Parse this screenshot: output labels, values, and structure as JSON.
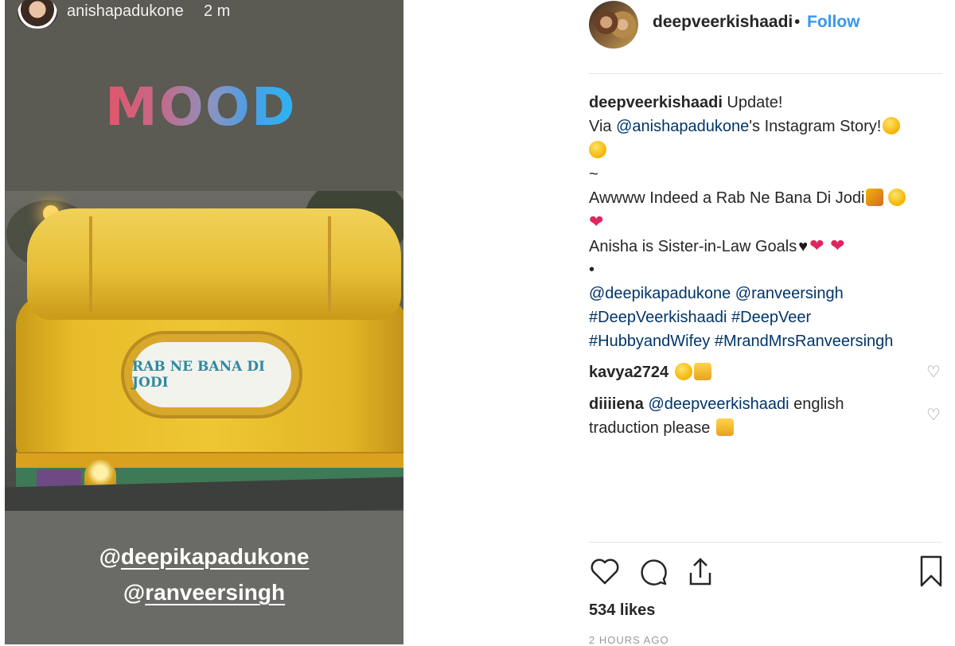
{
  "story": {
    "username": "anishapadukone",
    "time": "2 m",
    "sticker": "MOOD",
    "sign_text": "RAB NE BANA DI JODI",
    "mention_1": "deepikapadukone",
    "mention_2": "ranveersingh",
    "at": "@"
  },
  "post": {
    "username": "deepveerkishaadi",
    "dot": "•",
    "follow_label": "Follow",
    "caption": {
      "line1_user": "deepveerkishaadi",
      "line1_text": " Update!",
      "line2_pre": "Via ",
      "line2_mention": "@anishapadukone",
      "line2_post": "'s Instagram Story!",
      "line4": "~",
      "line5": "Awwww Indeed a Rab Ne Bana Di Jodi",
      "line7": "Anisha is Sister-in-Law Goals",
      "line8": "•",
      "line9_m1": "@deepikapadukone",
      "line9_m2": "@ranveersingh",
      "line10_t1": "#DeepVeerkishaadi",
      "line10_t2": "#DeepVeer",
      "line11_t1": "#HubbyandWifey",
      "line11_t2": "#MrandMrsRanveersingh"
    },
    "comments": [
      {
        "user": "kavya2724",
        "text": ""
      },
      {
        "user": "diiiiena",
        "mention": "@deepveerkishaadi",
        "text": " english",
        "text2": "traduction please"
      }
    ],
    "likes": "534 likes",
    "time": "2 HOURS AGO",
    "icons": [
      "heart-icon",
      "comment-icon",
      "share-icon",
      "bookmark-icon"
    ]
  }
}
